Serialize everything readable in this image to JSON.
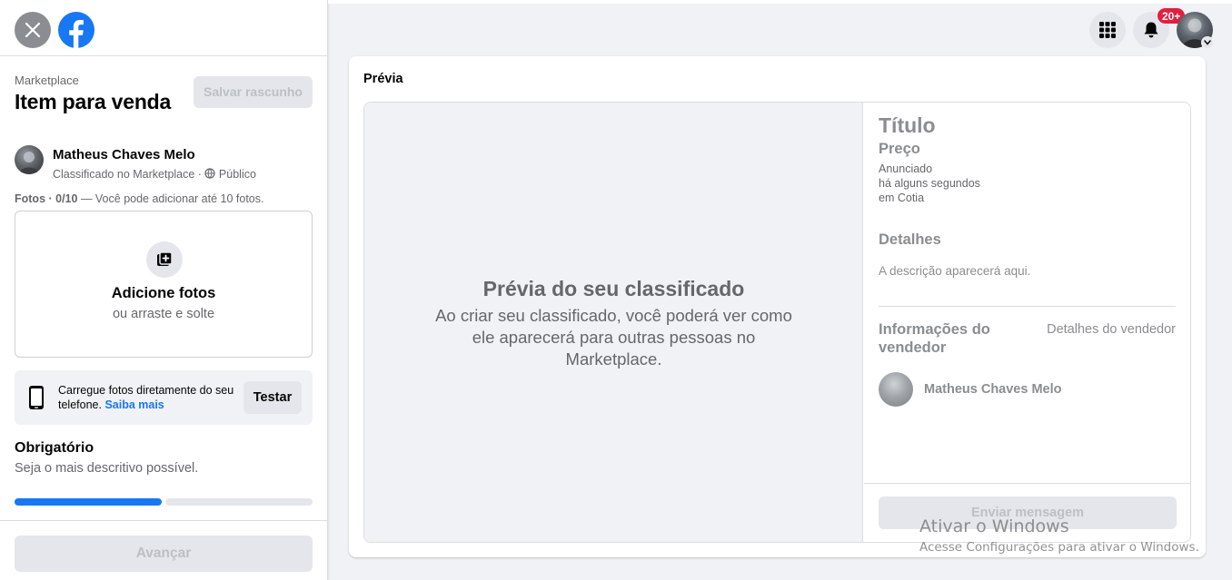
{
  "sidebar": {
    "breadcrumb": "Marketplace",
    "title": "Item para venda",
    "save_draft_label": "Salvar rascunho",
    "user": {
      "name": "Matheus Chaves Melo",
      "listing_type": "Classificado no Marketplace · ",
      "privacy": "Público"
    },
    "photos": {
      "label_bold": "Fotos · 0/10",
      "label_rest": " — Você pode adicionar até 10 fotos.",
      "add_title": "Adicione fotos",
      "add_subtitle": "ou arraste e solte"
    },
    "phone_upload": {
      "text": "Carregue fotos diretamente do seu telefone. ",
      "link": "Saiba mais",
      "button": "Testar"
    },
    "required": {
      "title": "Obrigatório",
      "subtitle": "Seja o mais descritivo possível."
    },
    "progress_fraction": 0.5,
    "next_label": "Avançar"
  },
  "topbar": {
    "menu_icon": "grid-menu-icon",
    "bell_icon": "bell-icon",
    "notification_count": "20+"
  },
  "preview": {
    "label": "Prévia",
    "placeholder_title": "Prévia do seu classificado",
    "placeholder_desc": "Ao criar seu classificado, você poderá ver como ele aparecerá para outras pessoas no Marketplace.",
    "info": {
      "title": "Título",
      "price": "Preço",
      "listed": "Anunciado",
      "time": "há alguns segundos",
      "location": "em Cotia",
      "details_title": "Detalhes",
      "details_desc": "A descrição aparecerá aqui.",
      "seller_title": "Informações do vendedor",
      "seller_link": "Detalhes do vendedor",
      "seller_name": "Matheus Chaves Melo",
      "send_label": "Enviar mensagem"
    }
  },
  "watermark": {
    "title": "Ativar o Windows",
    "subtitle": "Acesse Configurações para ativar o Windows."
  },
  "colors": {
    "brand": "#1877f2",
    "badge": "#e41e3f",
    "background": "#f0f2f5"
  }
}
